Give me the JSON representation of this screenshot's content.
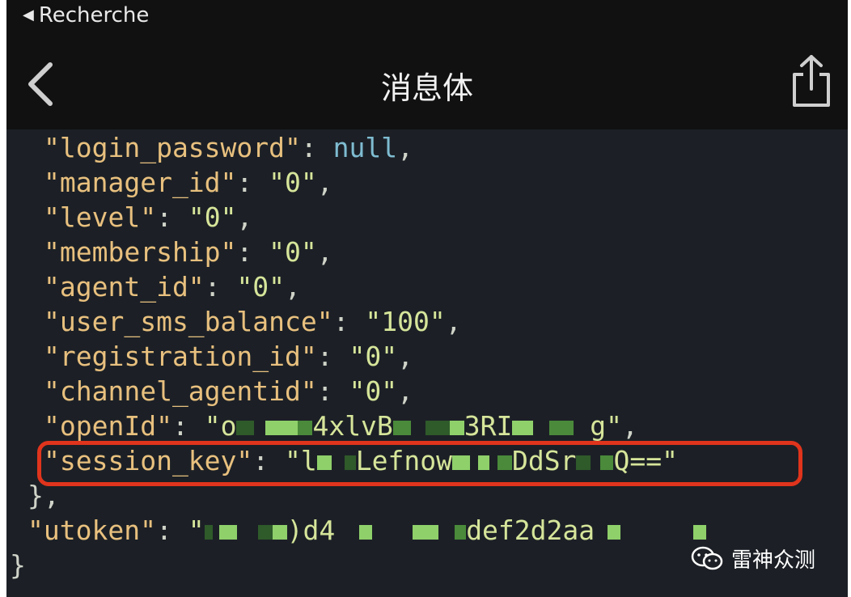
{
  "status_bar": {
    "back_app": "Recherche",
    "back_arrow_glyph": "◀"
  },
  "nav": {
    "title": "消息体",
    "back_icon": "chevron-left-icon",
    "share_icon": "share-icon"
  },
  "json_lines": [
    {
      "key": "\"login_password\"",
      "value": "null",
      "value_type": "null",
      "trail": ","
    },
    {
      "key": "\"manager_id\"",
      "value": "\"0\"",
      "value_type": "string",
      "trail": ","
    },
    {
      "key": "\"level\"",
      "value": "\"0\"",
      "value_type": "string",
      "trail": ","
    },
    {
      "key": "\"membership\"",
      "value": "\"0\"",
      "value_type": "string",
      "trail": ","
    },
    {
      "key": "\"agent_id\"",
      "value": "\"0\"",
      "value_type": "string",
      "trail": ","
    },
    {
      "key": "\"user_sms_balance\"",
      "value": "\"100\"",
      "value_type": "string",
      "trail": ","
    },
    {
      "key": "\"registration_id\"",
      "value": "\"0\"",
      "value_type": "string",
      "trail": ","
    },
    {
      "key": "\"channel_agentid\"",
      "value": "\"0\"",
      "value_type": "string",
      "trail": ","
    }
  ],
  "openid_line": {
    "key": "\"openId\"",
    "parts": [
      "\"o",
      "4xlvB",
      "3RI",
      "g\""
    ],
    "trail": ","
  },
  "session_line": {
    "key": "\"session_key\"",
    "parts": [
      "\"l",
      "Lefnow",
      "DdSr",
      "Q==\""
    ]
  },
  "close_brace": "},",
  "utoken_line": {
    "key": "\"utoken\"",
    "parts": [
      "\"",
      ")d4",
      "def2d2aa"
    ]
  },
  "final_brace": "}",
  "colon": ":",
  "watermark": {
    "text": "雷神众测",
    "icon": "wechat-icon"
  },
  "colors": {
    "key": "#e8c07e",
    "string": "#d6e59a",
    "null": "#7fbcd1",
    "highlight": "#e0341c"
  }
}
